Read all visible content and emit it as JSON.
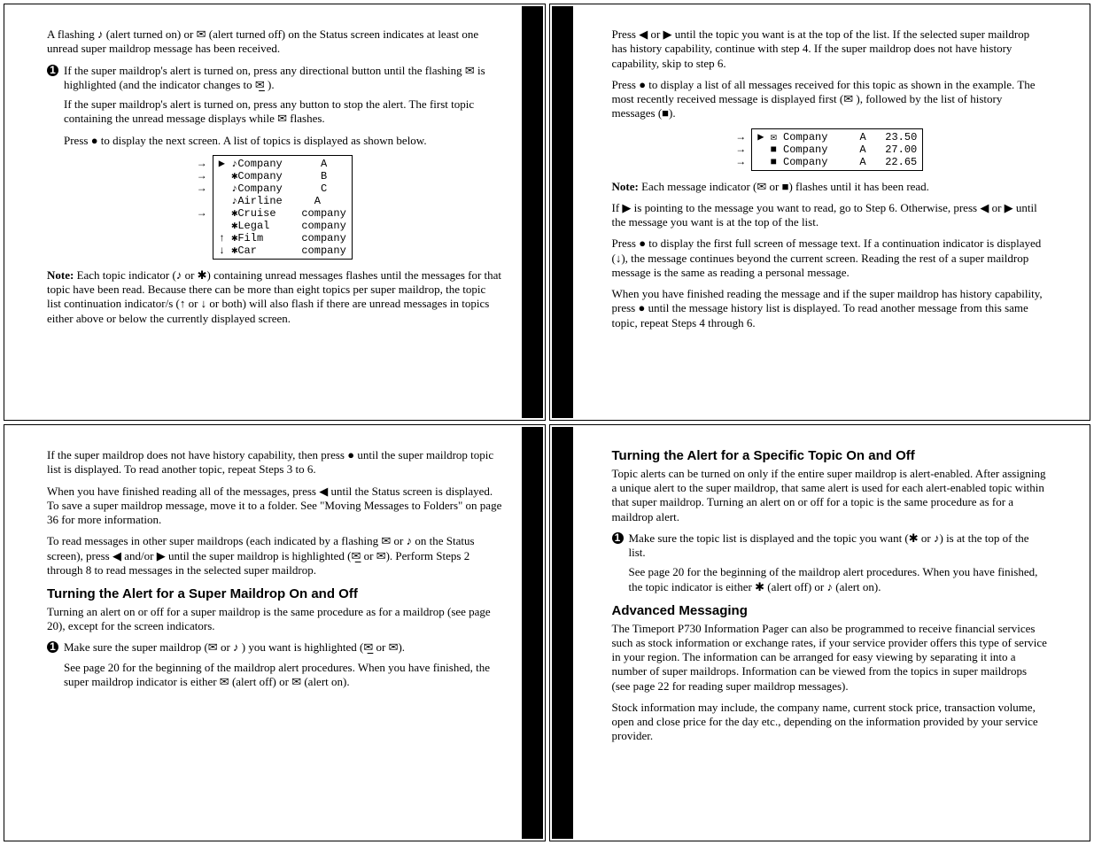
{
  "panel1": {
    "p1": "A flashing ♪ (alert turned on) or ✉ (alert turned off) on the Status screen indicates at least one unread super maildrop message has been received.",
    "b1": "If the super maildrop's alert is turned on, press any directional button until the flashing ✉ is highlighted (and the indicator changes to ✉̲ ).",
    "b1b": "If the super maildrop's alert is turned on, press any button to stop the alert. The first topic containing the unread message displays while ✉ flashes.",
    "b1c": "Press ● to display the next screen. A list of topics is displayed as shown below.",
    "lcd_arrows": [
      "→",
      "→",
      "→",
      "",
      "→",
      "",
      "",
      ""
    ],
    "lcd_lines": [
      "▶ ♪Company      A",
      "  ✱Company      B",
      "  ♪Company      C",
      "  ♪Airline     A",
      "  ✱Cruise    company",
      "  ✱Legal     company",
      "↑ ✱Film      company",
      "↓ ✱Car       company"
    ],
    "note": "Each topic indicator (♪ or ✱) containing unread messages flashes until the messages for that topic have been read. Because there can be more than eight topics per super maildrop, the topic list continuation indicator/s (↑ or ↓ or both) will also flash if there are unread messages in topics either above or below the currently displayed screen."
  },
  "panel2": {
    "p1": "Press ◀ or ▶ until the topic you want is at the top of the list. If the selected super maildrop has history capability, continue with step 4. If the super maildrop does not have history capability, skip to step 6.",
    "p2": "Press ● to display a list of all messages received for this topic as shown in the example. The most recently received message is displayed first (✉ ), followed by the list of history messages (■).",
    "lcd_arrows": [
      "→",
      "→",
      "→"
    ],
    "lcd_lines": [
      "▶ ✉ Company     A   23.50",
      "  ■ Company     A   27.00",
      "  ■ Company     A   22.65"
    ],
    "note": "Each message indicator (✉ or ■) flashes until it has been read.",
    "p3": "If ▶ is pointing to the message you want to read, go to Step 6. Otherwise, press ◀ or ▶ until the message you want is at the top of the list.",
    "p4": "Press ● to display the first full screen of message text. If a continuation indicator is displayed (↓), the message continues beyond the current screen. Reading the rest of a super maildrop message is the same as reading a personal message.",
    "p5": "When you have finished reading the message and if the super maildrop has history capability, press ● until the message history list is displayed. To read another message from this same topic, repeat Steps 4 through 6."
  },
  "panel3": {
    "p1": "If the super maildrop does not have history capability, then press ● until the super maildrop topic list is displayed. To read another topic, repeat Steps 3 to 6.",
    "p2": "When you have finished reading all of the messages, press ◀ until the Status screen is displayed. To save a super maildrop message, move it to a folder. See \"Moving Messages to Folders\" on page 36 for more information.",
    "p3": "To read messages in other super maildrops (each indicated by a flashing ✉ or ♪ on the Status screen), press ◀ and/or ▶ until the super maildrop is highlighted (✉̲ or ✉). Perform Steps 2 through 8 to read messages in the selected super maildrop.",
    "h1": "Turning the Alert for a Super Maildrop On and Off",
    "p4": "Turning an alert on or off for a super maildrop is the same procedure as for a maildrop (see page 20), except for the screen indicators.",
    "b1": "Make sure the super maildrop (✉ or ♪ ) you want is highlighted (✉̲ or ✉).",
    "b1b": "See page 20 for the beginning of the maildrop alert procedures. When you have finished, the super maildrop indicator is either ✉ (alert off) or ✉ (alert on)."
  },
  "panel4": {
    "h1": "Turning the Alert for a Specific Topic On and Off",
    "p1": "Topic alerts can be turned on only if the entire super maildrop is alert-enabled. After assigning a unique alert to the super maildrop, that same alert is used for each alert-enabled topic within that super maildrop. Turning an alert on or off for a topic is the same procedure as for a maildrop alert.",
    "b1": "Make sure the topic list is displayed and the topic you want (✱ or ♪) is at the top of the list.",
    "b1b": "See page 20 for the beginning of the maildrop alert procedures. When you have finished, the topic indicator is either ✱ (alert off) or ♪ (alert on).",
    "h2": "Advanced Messaging",
    "p2": "The Timeport P730 Information Pager can also be programmed to receive financial services such as stock information or exchange rates, if your service provider offers this type of service in your region. The information can be arranged for easy viewing by separating it into a number of super maildrops. Information can be viewed from the topics in super maildrops (see page 22 for reading super maildrop messages).",
    "p3": "Stock information may include, the company name, current stock price, transaction volume, open and close price for the day etc., depending on the information provided by your service provider."
  }
}
